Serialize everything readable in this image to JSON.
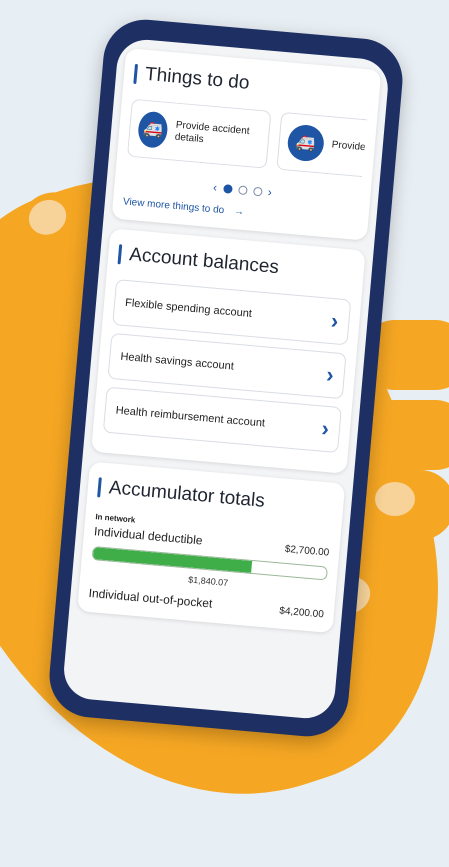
{
  "things_to_do": {
    "title": "Things to do",
    "tasks": [
      {
        "label": "Provide accident details",
        "icon": "ambulance-icon"
      },
      {
        "label": "Provide accident",
        "icon": "ambulance-icon"
      }
    ],
    "pager": {
      "prev": "‹",
      "next": "›",
      "active_index": 0,
      "count": 3
    },
    "view_more": "View more things to do",
    "view_more_arrow": "→"
  },
  "account_balances": {
    "title": "Account balances",
    "items": [
      {
        "label": "Flexible spending account"
      },
      {
        "label": "Health savings account"
      },
      {
        "label": "Health reimbursement account"
      }
    ],
    "chevron": "›"
  },
  "accumulator": {
    "title": "Accumulator totals",
    "network_label": "In network",
    "items": [
      {
        "label": "Individual deductible",
        "limit": "$2,700.00",
        "spent": "$1,840.07",
        "progress": 0.68
      },
      {
        "label": "Individual out-of-pocket",
        "limit": "$4,200.00"
      }
    ]
  },
  "colors": {
    "accent": "#1f55a5",
    "phone": "#1d2f63",
    "hand": "#f5a623",
    "progress": "#3fae49"
  }
}
